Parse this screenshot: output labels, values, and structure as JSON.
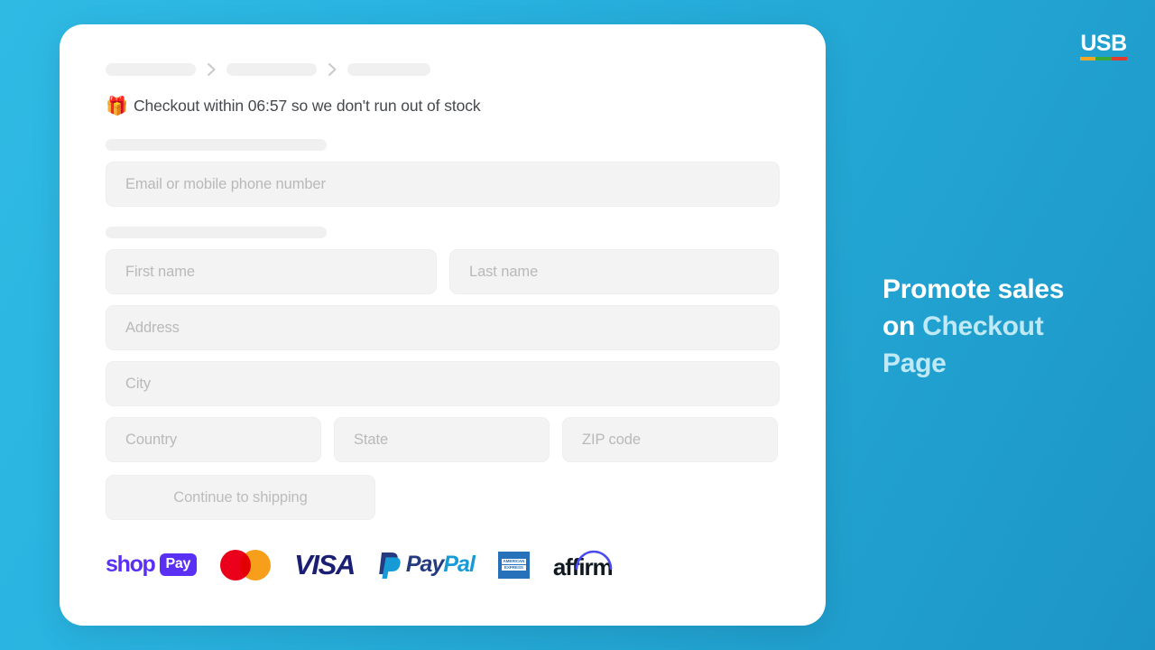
{
  "brand": {
    "name": "USB",
    "bar_colors": [
      "#f5a623",
      "#3aa93a",
      "#e03b2f"
    ]
  },
  "headline": {
    "line1": "Promote sales",
    "line2_plain": "on ",
    "line2_accent": "Checkout",
    "line3_accent": "Page",
    "color_white": "#ffffff",
    "color_accent": "#bfe9f6"
  },
  "background": {
    "from": "#2fbae4",
    "to": "#1c95c6"
  },
  "checkout": {
    "breadcrumb": {
      "separator_icon": "chevron-right-icon",
      "steps": [
        "",
        "",
        ""
      ]
    },
    "promo": {
      "icon": "gift-box-icon",
      "emoji": "🎁",
      "text": "Checkout within 06:57 so we don't run out of stock",
      "countdown": "06:57"
    },
    "contact_label": "",
    "email_field": {
      "placeholder": "Email or mobile phone number",
      "value": ""
    },
    "shipping_label": "",
    "fields": {
      "first_name": "First name",
      "last_name": "Last name",
      "address": "Address",
      "city": "City",
      "country": "Country",
      "state": "State",
      "zip": "ZIP code"
    },
    "continue_button": "Continue to shipping",
    "payments": [
      {
        "id": "shop-pay",
        "word": "shop",
        "pill": "Pay",
        "color": "#5a31f4"
      },
      {
        "id": "mastercard",
        "word": "",
        "color_left": "#eb001b",
        "color_right": "#f79e1b"
      },
      {
        "id": "visa",
        "word": "VISA",
        "color": "#1a1f71"
      },
      {
        "id": "paypal",
        "word_a": "Pay",
        "word_b": "Pal",
        "color_a": "#253b80",
        "color_b": "#179bd7"
      },
      {
        "id": "amex",
        "line1": "AMERICAN",
        "line2": "EXPRESS",
        "color": "#2671b9"
      },
      {
        "id": "affirm",
        "word": "affirm",
        "color": "#101820",
        "arc_color": "#4a4af4"
      }
    ]
  }
}
